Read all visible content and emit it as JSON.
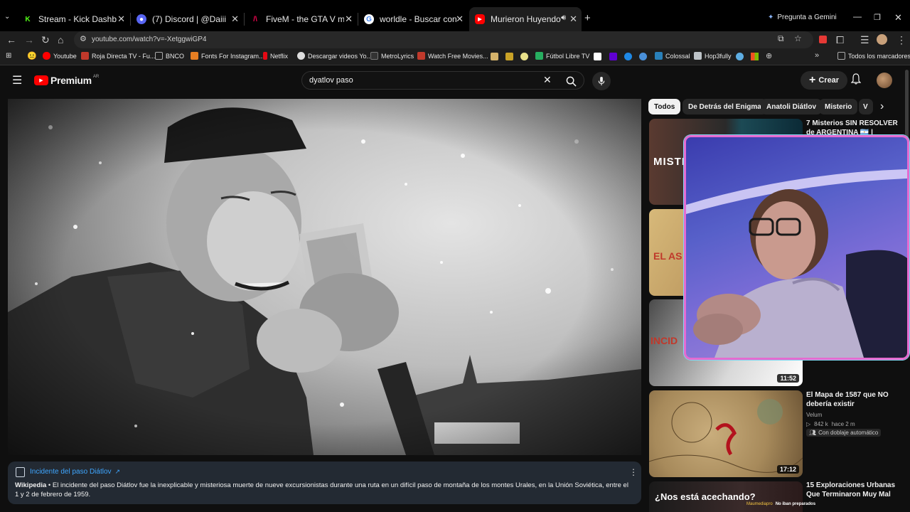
{
  "browser": {
    "tabs": [
      {
        "label": "Stream - Kick Dashboard",
        "icon": "kick-icon",
        "color": "#53fc18"
      },
      {
        "label": "(7) Discord | @Daiii",
        "icon": "discord-icon",
        "color": "#5865f2"
      },
      {
        "label": "FiveM - the GTA V multiplayer",
        "icon": "fivem-icon",
        "color": "#f40552"
      },
      {
        "label": "worldle - Buscar con Google",
        "icon": "google-icon",
        "color": "#4285f4"
      },
      {
        "label": "Murieron Huyendo de Algo",
        "icon": "youtube-icon",
        "color": "#ff0000"
      }
    ],
    "gemini_label": "Pregunta a Gemini",
    "url": "youtube.com/watch?v=-XetggwiGP4",
    "bookmarks": [
      {
        "label": "Youtube",
        "color": "#ff0000"
      },
      {
        "label": "Roja Directa TV - Fu...",
        "color": "#c0392b"
      },
      {
        "label": "BNCO",
        "color": "#888888"
      },
      {
        "label": "Fonts For Instagram...",
        "color": "#e67e22"
      },
      {
        "label": "Netflix",
        "color": "#e50914"
      },
      {
        "label": "Descargar videos Yo...",
        "color": "#dddddd"
      },
      {
        "label": "MetroLyrics",
        "color": "#333333"
      },
      {
        "label": "Watch Free Movies...",
        "color": "#c0392b"
      },
      {
        "label": "Fútbol Libre TV",
        "color": "#27ae60"
      },
      {
        "label": "Colossal",
        "color": "#2980b9"
      },
      {
        "label": "Hop3fully",
        "color": "#bdc3c7"
      }
    ],
    "all_bookmarks_label": "Todos los marcadores"
  },
  "youtube": {
    "logo_label": "Premium",
    "country_code": "AR",
    "search_value": "dyatlov paso",
    "create_label": "Crear"
  },
  "info_card": {
    "title": "Incidente del paso Diátlov",
    "source": "Wikipedia",
    "text": "El incidente del paso Diátlov fue la inexplicable y misteriosa muerte de nueve excursionistas durante una ruta en un difícil paso de montaña de los montes Urales, en la Unión Soviética, entre el 1 y 2 de febrero de 1959."
  },
  "chips": [
    "Todos",
    "De Detrás del Enigma",
    "Anatoli Diátlov",
    "Misterio",
    "V"
  ],
  "recommendations": [
    {
      "title": "7 Misterios SIN RESOLVER de ARGENTINA 🇦🇷 |",
      "thumb_text": "MISTE",
      "duration": ""
    },
    {
      "title": "",
      "thumb_text": "EL AS",
      "duration": ""
    },
    {
      "title": "",
      "thumb_text": "INCID",
      "duration": "11:52"
    },
    {
      "title": "El Mapa de 1587 que NO debería existir",
      "channel": "Velum",
      "views": "842 k",
      "age": "hace 2 m",
      "badge": "Con doblaje automático",
      "duration": "17:12"
    },
    {
      "title": "15 Exploraciones Urbanas Que Terminaron Muy Mal",
      "thumb_text": "¿Nos está acechando?",
      "duration": ""
    }
  ],
  "webcam_caption": {
    "name": "Maumediapro",
    "text": "No iban preparados"
  }
}
